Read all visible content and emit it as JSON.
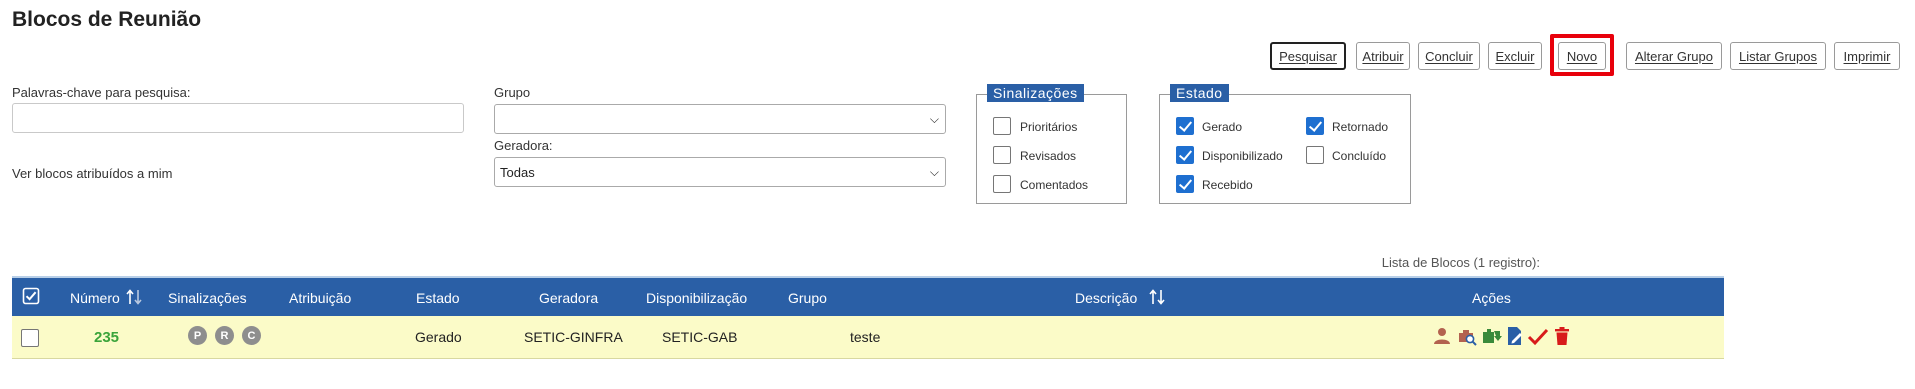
{
  "page": {
    "title": "Blocos de Reunião"
  },
  "toolbar": {
    "pesquisar": "Pesquisar",
    "atribuir": "Atribuir",
    "concluir": "Concluir",
    "excluir": "Excluir",
    "novo": "Novo",
    "alterar_grupo": "Alterar Grupo",
    "listar_grupos": "Listar Grupos",
    "imprimir": "Imprimir"
  },
  "filters": {
    "keywords_label": "Palavras-chave para pesquisa:",
    "keywords_value": "",
    "assigned_label": "Ver blocos atribuídos a mim",
    "grupo_label": "Grupo",
    "grupo_value": "",
    "geradora_label": "Geradora:",
    "geradora_value": "Todas"
  },
  "sinalizacoes": {
    "legend": "Sinalizações",
    "items": [
      {
        "label": "Prioritários",
        "checked": false
      },
      {
        "label": "Revisados",
        "checked": false
      },
      {
        "label": "Comentados",
        "checked": false
      }
    ]
  },
  "estado": {
    "legend": "Estado",
    "items": [
      {
        "label": "Gerado",
        "checked": true
      },
      {
        "label": "Retornado",
        "checked": true
      },
      {
        "label": "Disponibilizado",
        "checked": true
      },
      {
        "label": "Concluído",
        "checked": false
      },
      {
        "label": "Recebido",
        "checked": true
      }
    ]
  },
  "table": {
    "caption": "Lista de Blocos (1 registro):",
    "headers": {
      "numero": "Número",
      "sinalizacoes": "Sinalizações",
      "atribuicao": "Atribuição",
      "estado": "Estado",
      "geradora": "Geradora",
      "disponibilizacao": "Disponibilização",
      "grupo": "Grupo",
      "descricao": "Descrição",
      "acoes": "Ações"
    },
    "rows": [
      {
        "numero": "235",
        "badges": [
          "P",
          "R",
          "C"
        ],
        "atribuicao": "",
        "estado": "Gerado",
        "geradora": "SETIC-GINFRA",
        "disponibilizacao": "SETIC-GAB",
        "grupo": "",
        "descricao": "teste"
      }
    ]
  },
  "colors": {
    "header_blue": "#2a5fa6",
    "row_yellow": "#fbfbc8",
    "number_green": "#3aa43a",
    "highlight_red": "#e8000b",
    "checkbox_blue": "#1e6fd0"
  }
}
